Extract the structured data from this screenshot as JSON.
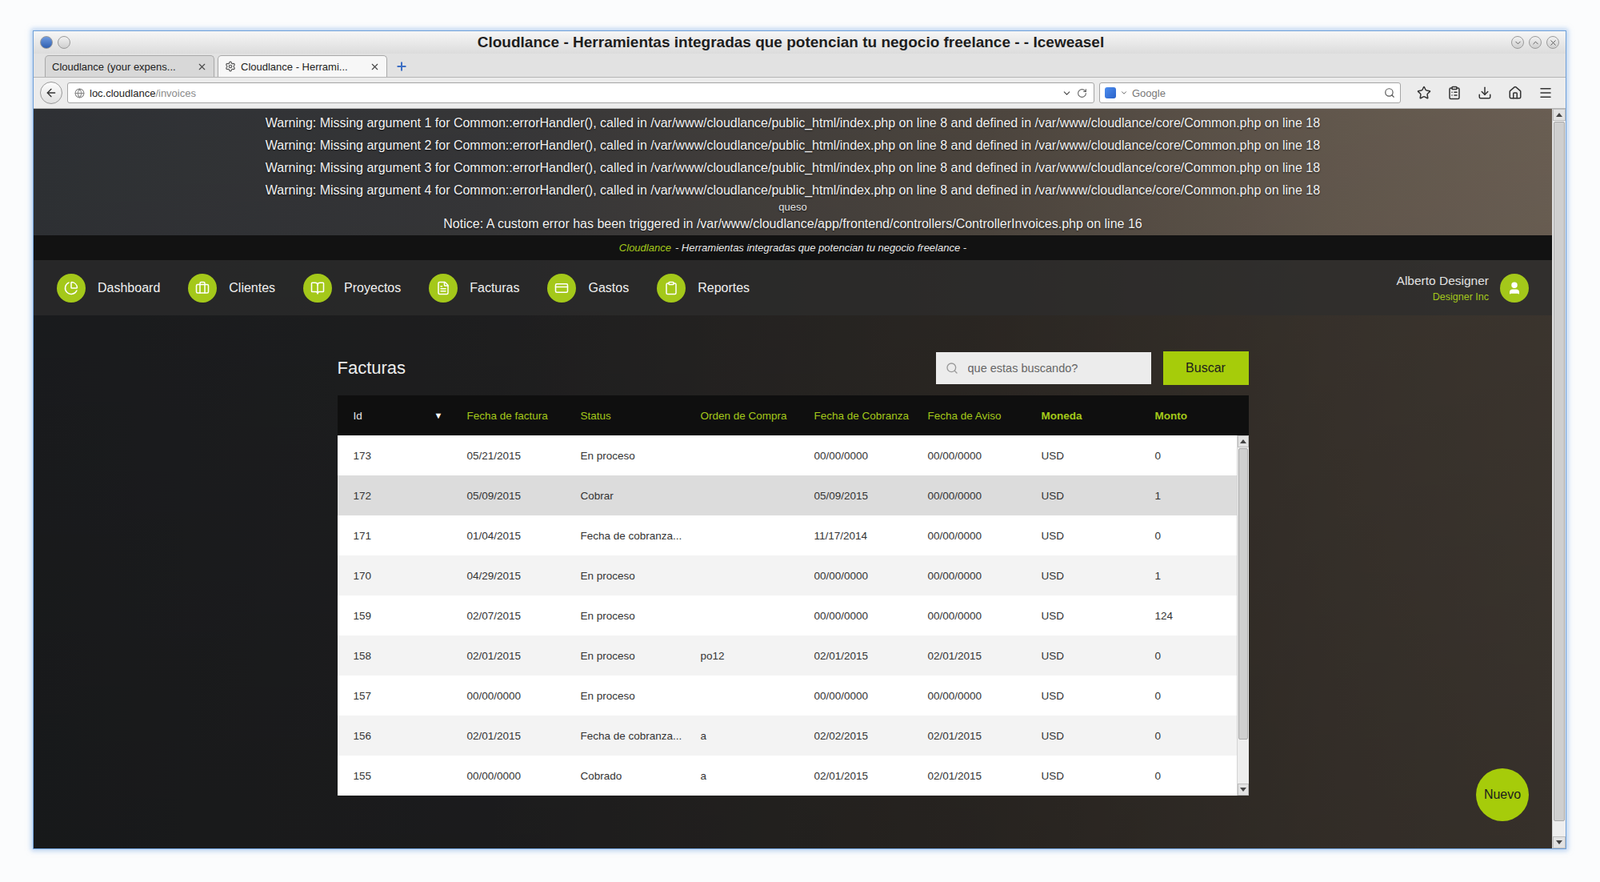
{
  "window": {
    "title": "Cloudlance - Herramientas integradas que potencian tu negocio freelance - - Iceweasel"
  },
  "tabs": [
    {
      "label": "Cloudlance (your expens...",
      "selected": false
    },
    {
      "label": "Cloudlance - Herrami...",
      "selected": true
    }
  ],
  "address_bar": {
    "host": "loc.cloudlance",
    "path": "/invoices"
  },
  "browser_search": {
    "placeholder": "Google"
  },
  "messages": [
    {
      "kind": "warning",
      "text": "Warning: Missing argument 1 for Common::errorHandler(), called in /var/www/cloudlance/public_html/index.php on line 8 and defined in /var/www/cloudlance/core/Common.php on line 18"
    },
    {
      "kind": "warning",
      "text": "Warning: Missing argument 2 for Common::errorHandler(), called in /var/www/cloudlance/public_html/index.php on line 8 and defined in /var/www/cloudlance/core/Common.php on line 18"
    },
    {
      "kind": "warning",
      "text": "Warning: Missing argument 3 for Common::errorHandler(), called in /var/www/cloudlance/public_html/index.php on line 8 and defined in /var/www/cloudlance/core/Common.php on line 18"
    },
    {
      "kind": "warning",
      "text": "Warning: Missing argument 4 for Common::errorHandler(), called in /var/www/cloudlance/public_html/index.php on line 8 and defined in /var/www/cloudlance/core/Common.php on line 18"
    },
    {
      "kind": "debug",
      "text": "queso"
    },
    {
      "kind": "notice",
      "text": "Notice: A custom error has been triggered in /var/www/cloudlance/app/frontend/controllers/ControllerInvoices.php on line 16"
    }
  ],
  "tagline": {
    "brand": "Cloudlance",
    "text": "- Herramientas integradas que potencian tu negocio freelance -"
  },
  "nav": {
    "items": [
      {
        "label": "Dashboard"
      },
      {
        "label": "Clientes"
      },
      {
        "label": "Proyectos"
      },
      {
        "label": "Facturas"
      },
      {
        "label": "Gastos"
      },
      {
        "label": "Reportes"
      }
    ]
  },
  "user": {
    "name": "Alberto Designer",
    "company": "Designer Inc"
  },
  "page": {
    "title": "Facturas",
    "search_placeholder": "que estas buscando?",
    "search_button": "Buscar",
    "new_button": "Nuevo"
  },
  "table": {
    "columns": [
      {
        "label": "Id",
        "sorted": true,
        "sort_indicator": "▼",
        "emphasized": false
      },
      {
        "label": "Fecha de factura",
        "sorted": false,
        "sort_indicator": "",
        "emphasized": false
      },
      {
        "label": "Status",
        "sorted": false,
        "sort_indicator": "",
        "emphasized": false
      },
      {
        "label": "Orden de Compra",
        "sorted": false,
        "sort_indicator": "",
        "emphasized": false
      },
      {
        "label": "Fecha de Cobranza",
        "sorted": false,
        "sort_indicator": "",
        "emphasized": false
      },
      {
        "label": "Fecha de Aviso",
        "sorted": false,
        "sort_indicator": "",
        "emphasized": false
      },
      {
        "label": "Moneda",
        "sorted": false,
        "sort_indicator": "",
        "emphasized": true
      },
      {
        "label": "Monto",
        "sorted": false,
        "sort_indicator": "",
        "emphasized": true
      }
    ],
    "rows": [
      {
        "cells": [
          "173",
          "05/21/2015",
          "En proceso",
          "",
          "00/00/0000",
          "00/00/0000",
          "USD",
          "0"
        ],
        "selected": false
      },
      {
        "cells": [
          "172",
          "05/09/2015",
          "Cobrar",
          "",
          "05/09/2015",
          "00/00/0000",
          "USD",
          "1"
        ],
        "selected": true
      },
      {
        "cells": [
          "171",
          "01/04/2015",
          "Fecha de cobranza...",
          "",
          "11/17/2014",
          "00/00/0000",
          "USD",
          "0"
        ],
        "selected": false
      },
      {
        "cells": [
          "170",
          "04/29/2015",
          "En proceso",
          "",
          "00/00/0000",
          "00/00/0000",
          "USD",
          "1"
        ],
        "selected": false
      },
      {
        "cells": [
          "159",
          "02/07/2015",
          "En proceso",
          "",
          "00/00/0000",
          "00/00/0000",
          "USD",
          "124"
        ],
        "selected": false
      },
      {
        "cells": [
          "158",
          "02/01/2015",
          "En proceso",
          "po12",
          "02/01/2015",
          "02/01/2015",
          "USD",
          "0"
        ],
        "selected": false
      },
      {
        "cells": [
          "157",
          "00/00/0000",
          "En proceso",
          "",
          "00/00/0000",
          "00/00/0000",
          "USD",
          "0"
        ],
        "selected": false
      },
      {
        "cells": [
          "156",
          "02/01/2015",
          "Fecha de cobranza...",
          "a",
          "02/02/2015",
          "02/01/2015",
          "USD",
          "0"
        ],
        "selected": false
      },
      {
        "cells": [
          "155",
          "00/00/0000",
          "Cobrado",
          "a",
          "02/01/2015",
          "02/01/2015",
          "USD",
          "0"
        ],
        "selected": false
      }
    ],
    "scrollbar": {
      "level": 0.87
    }
  },
  "page_scrollbar": {
    "level": 0.98
  }
}
